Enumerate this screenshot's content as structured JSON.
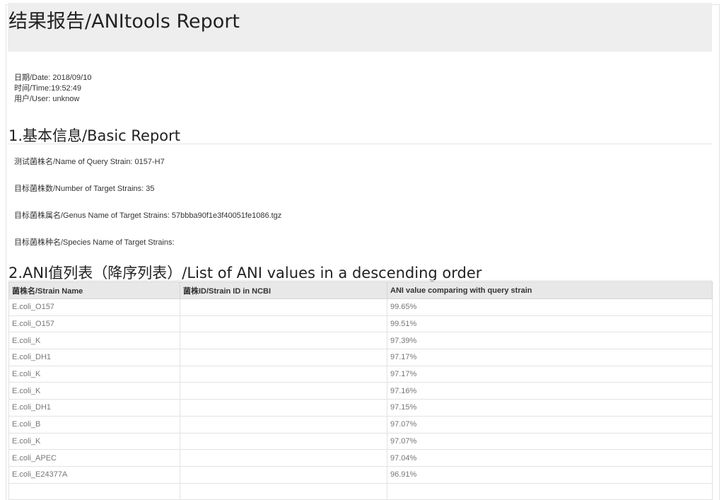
{
  "header": {
    "title": "结果报告/ANItools Report"
  },
  "meta": {
    "date": "日期/Date: 2018/09/10",
    "time": "时间/Time:19:52:49",
    "user": "用户/User: unknow"
  },
  "basic": {
    "heading": "1.基本信息/Basic Report",
    "query_strain": "测试菌株名/Name of Query Strain: 0157-H7",
    "target_count": "目标菌株数/Number of Target Strains: 35",
    "genus": "目标菌株属名/Genus Name of Target Strains: 57bbba90f1e3f40051fe1086.tgz",
    "species": "目标菌株种名/Species Name of Target Strains:"
  },
  "ani": {
    "heading": "2.ANI值列表（降序列表）/List of ANI values in a descending order",
    "columns": [
      "菌株名/Strain Name",
      "菌株ID/Strain ID in NCBI",
      "ANI value comparing with query strain"
    ],
    "rows": [
      [
        "E.coli_O157",
        "",
        "99.65%"
      ],
      [
        "E.coli_O157",
        "",
        "99.51%"
      ],
      [
        "E.coli_K",
        "",
        "97.39%"
      ],
      [
        "E.coli_DH1",
        "",
        "97.17%"
      ],
      [
        "E.coli_K",
        "",
        "97.17%"
      ],
      [
        "E.coli_K",
        "",
        "97.16%"
      ],
      [
        "E.coli_DH1",
        "",
        "97.15%"
      ],
      [
        "E.coli_B",
        "",
        "97.07%"
      ],
      [
        "E.coli_K",
        "",
        "97.07%"
      ],
      [
        "E.coli_APEC",
        "",
        "97.04%"
      ],
      [
        "E.coli_E24377A",
        "",
        "96.91%"
      ],
      [
        "",
        "",
        ""
      ]
    ]
  }
}
